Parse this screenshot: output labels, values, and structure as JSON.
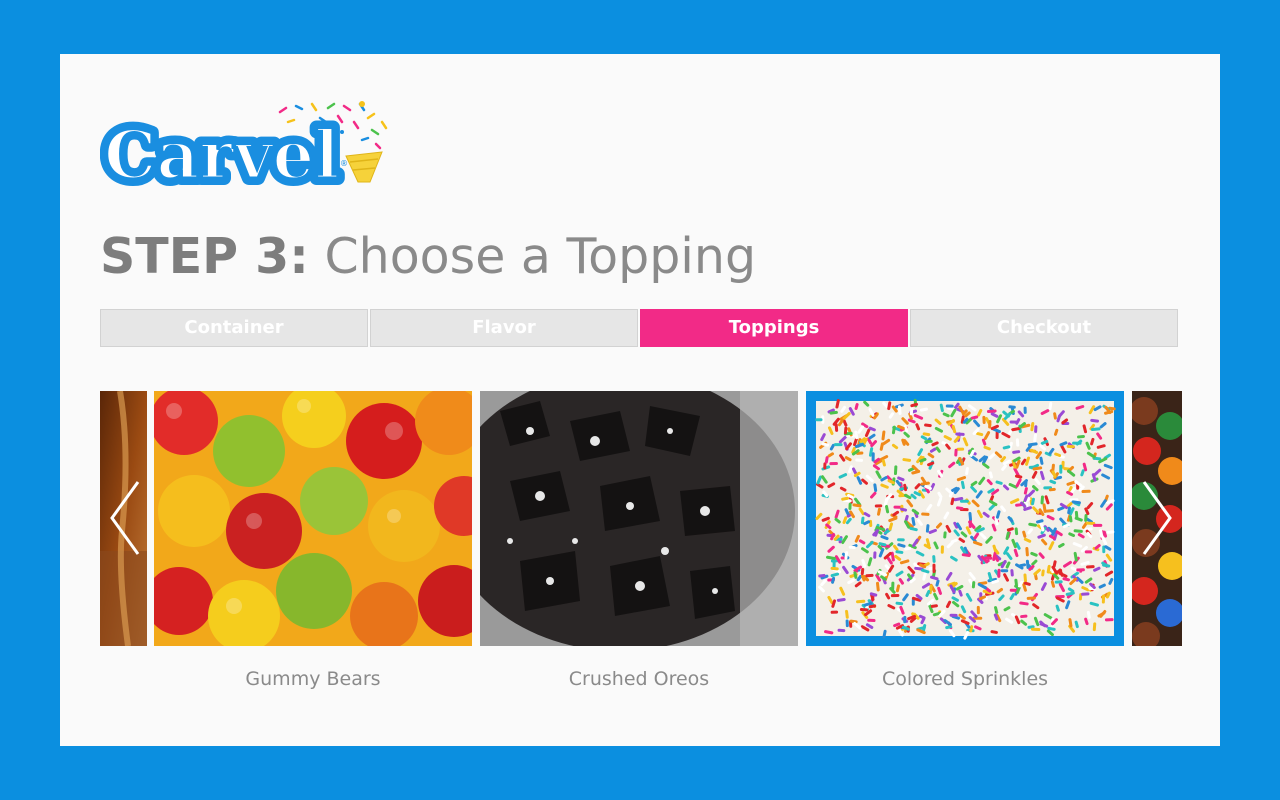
{
  "brand": {
    "name": "Carvel"
  },
  "heading": {
    "step": "STEP 3:",
    "text": "Choose a Topping"
  },
  "tabs": [
    {
      "label": "Container",
      "active": false
    },
    {
      "label": "Flavor",
      "active": false
    },
    {
      "label": "Toppings",
      "active": true
    },
    {
      "label": "Checkout",
      "active": false
    }
  ],
  "toppings": [
    {
      "label": "Gummy Bears",
      "selected": false
    },
    {
      "label": "Crushed Oreos",
      "selected": false
    },
    {
      "label": "Colored Sprinkles",
      "selected": true
    }
  ],
  "carousel": {
    "prev_icon": "chevron-left-icon",
    "next_icon": "chevron-right-icon"
  },
  "colors": {
    "frame": "#0b8fe0",
    "active_tab": "#f22a87",
    "inactive_tab": "#e6e6e6",
    "selection_border": "#0b8fe0",
    "text_gray": "#8a8a8a"
  }
}
